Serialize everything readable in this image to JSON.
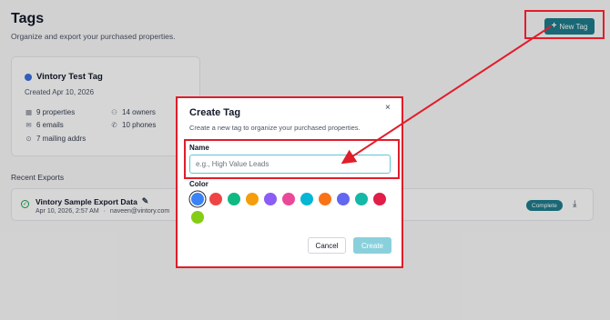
{
  "header": {
    "title": "Tags",
    "subtitle": "Organize and export your purchased properties.",
    "new_tag_label": "New Tag",
    "new_tag_icon": "plus-icon"
  },
  "tag_card": {
    "name": "Vintory Test Tag",
    "dot_color": "#3b6fe0",
    "created": "Created Apr 10, 2026",
    "stats": {
      "properties": "9 properties",
      "owners": "14 owners",
      "emails": "6 emails",
      "phones": "10 phones",
      "mailing": "7 mailing addrs"
    }
  },
  "recent_exports": {
    "label": "Recent Exports",
    "items": [
      {
        "name": "Vintory Sample Export Data",
        "date": "Apr 10, 2026, 2:57 AM",
        "separator": "·",
        "user": "naveen@vintory.com",
        "status": "Complete"
      }
    ]
  },
  "modal": {
    "title": "Create Tag",
    "description": "Create a new tag to organize your purchased properties.",
    "close_glyph": "×",
    "name_label": "Name",
    "name_placeholder": "e.g., High Value Leads",
    "name_value": "",
    "color_label": "Color",
    "colors": [
      "#3b82f6",
      "#ef4444",
      "#10b981",
      "#f59e0b",
      "#8b5cf6",
      "#ec4899",
      "#06b6d4",
      "#f97316",
      "#6366f1",
      "#14b8a6",
      "#e11d48",
      "#84cc16"
    ],
    "selected_color": "#3b82f6",
    "cancel_label": "Cancel",
    "create_label": "Create"
  },
  "annotation_color": "#e11d2a"
}
